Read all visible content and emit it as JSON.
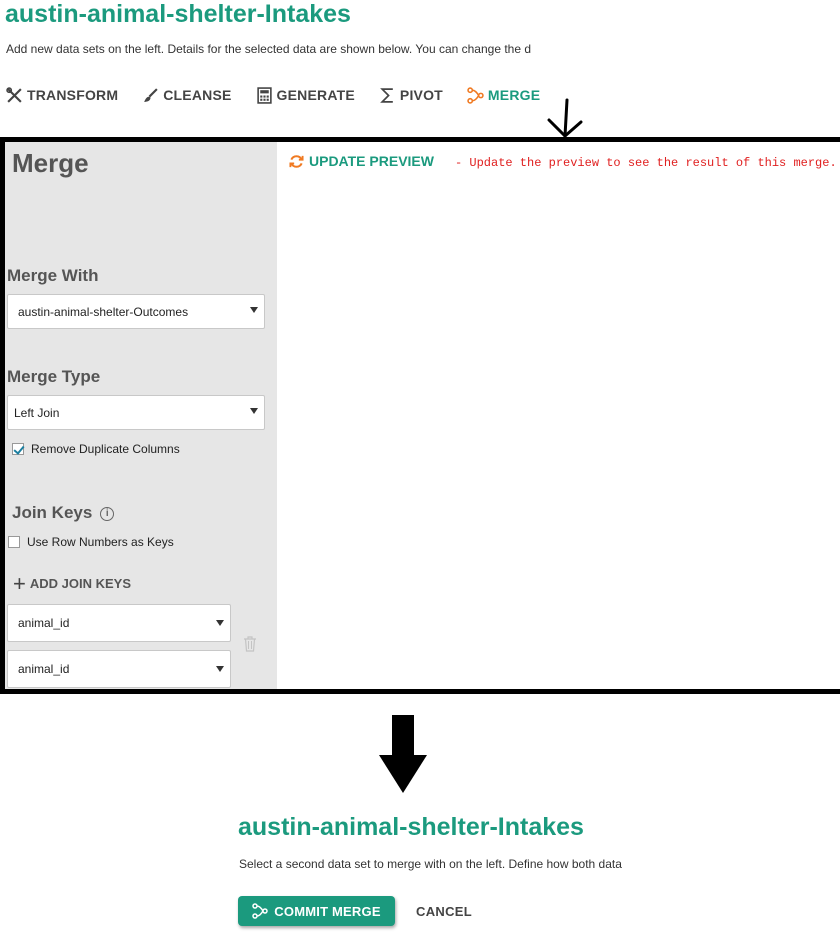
{
  "header": {
    "title": "austin-animal-shelter-Intakes",
    "subtitle": "Add new data sets on the left.  Details for the selected data are shown below.  You can change the d"
  },
  "toolbar": {
    "items": [
      {
        "label": "TRANSFORM",
        "icon": "tools-icon"
      },
      {
        "label": "CLEANSE",
        "icon": "brush-icon"
      },
      {
        "label": "GENERATE",
        "icon": "calculator-icon"
      },
      {
        "label": "PIVOT",
        "icon": "sigma-icon"
      },
      {
        "label": "MERGE",
        "icon": "merge-icon",
        "active": true
      }
    ]
  },
  "merge_panel": {
    "heading": "Merge",
    "merge_with_label": "Merge With",
    "merge_with_value": "austin-animal-shelter-Outcomes",
    "merge_type_label": "Merge Type",
    "merge_type_value": "Left Join",
    "remove_duplicates_label": "Remove Duplicate Columns",
    "remove_duplicates_checked": true,
    "join_keys_label": "Join Keys",
    "row_numbers_label": "Use Row Numbers as Keys",
    "row_numbers_checked": false,
    "add_join_keys_label": "ADD JOIN KEYS",
    "join_keys": [
      "animal_id",
      "animal_id"
    ]
  },
  "preview": {
    "update_label": "UPDATE PREVIEW",
    "message": "-  Update the preview to see the result of this merge."
  },
  "footer": {
    "title": "austin-animal-shelter-Intakes",
    "subtitle": "Select a second data set to merge with on the left.  Define how both data",
    "commit_label": "COMMIT MERGE",
    "cancel_label": "CANCEL"
  },
  "colors": {
    "accent": "#1b9a7e",
    "merge_icon": "#f07a22",
    "error": "#e02020",
    "panel_bg": "#e6e6e6"
  }
}
